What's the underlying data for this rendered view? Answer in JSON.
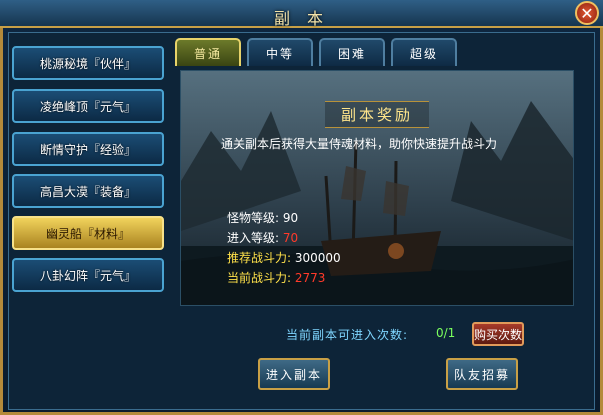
{
  "window": {
    "title": "副 本",
    "close_symbol": "✕"
  },
  "sidebar": {
    "items": [
      {
        "label": "桃源秘境『伙伴』",
        "active": false
      },
      {
        "label": "凌绝峰顶『元气』",
        "active": false
      },
      {
        "label": "断情守护『经验』",
        "active": false
      },
      {
        "label": "高昌大漠『装备』",
        "active": false
      },
      {
        "label": "幽灵船『材料』",
        "active": true
      },
      {
        "label": "八卦幻阵『元气』",
        "active": false
      }
    ]
  },
  "tabs": [
    {
      "label": "普通",
      "active": true
    },
    {
      "label": "中等",
      "active": false
    },
    {
      "label": "困难",
      "active": false
    },
    {
      "label": "超级",
      "active": false
    }
  ],
  "panel": {
    "title": "副本奖励",
    "description": "通关副本后获得大量侍魂材料，助你快速提升战斗力",
    "stats": [
      {
        "label": "怪物等级:",
        "value": "90",
        "label_color": "white",
        "value_color": "white"
      },
      {
        "label": "进入等级:",
        "value": "70",
        "label_color": "white",
        "value_color": "red"
      },
      {
        "label": "推荐战斗力:",
        "value": "300000",
        "label_color": "yellow",
        "value_color": "white"
      },
      {
        "label": "当前战斗力:",
        "value": "2773",
        "label_color": "yellow",
        "value_color": "red"
      }
    ]
  },
  "footer": {
    "entry_label": "当前副本可进入次数:",
    "entry_count": "0/1",
    "buy_label": "购买次数",
    "enter_label": "进入副本",
    "recruit_label": "队友招募"
  },
  "colors": {
    "accent_gold": "#c8a046",
    "active_item": "#f1d35c",
    "red_value": "#ff3a2a",
    "count_green": "#7bff5e"
  }
}
